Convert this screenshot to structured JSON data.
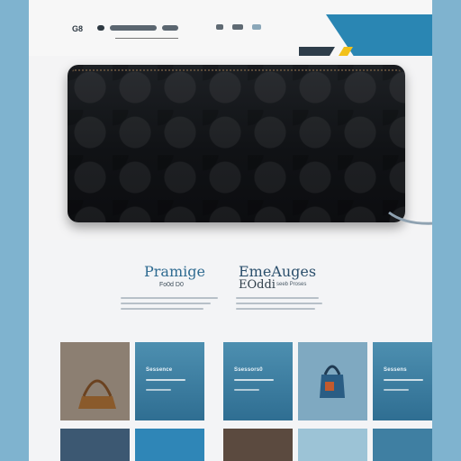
{
  "header": {
    "logo_text": "G8",
    "nav_pill_count": 5,
    "accent_color": "#2f6e92"
  },
  "hero": {
    "product_label": "wallet"
  },
  "headlines": {
    "left_title": "Pramige",
    "right_title": "EmeAuges",
    "left_sub": "Fo0d D0",
    "right_sub_big": "EOddi",
    "right_sub_small": "seeb Proses"
  },
  "tiles": [
    {
      "label": "Sessence",
      "kind": "photo-bag"
    },
    {
      "label": "Sessence",
      "kind": "info"
    },
    {
      "label": "Ssessors0",
      "kind": "info"
    },
    {
      "label": "",
      "kind": "photo-bag-hanging"
    },
    {
      "label": "Sessens",
      "kind": "info"
    }
  ],
  "colors": {
    "bg_outer": "#7fb3cf",
    "tile_blue": "#3f7fa2",
    "deco_blue": "#2a86b3",
    "deco_yellow": "#f2c11a",
    "deco_tan": "#9a8e84"
  }
}
